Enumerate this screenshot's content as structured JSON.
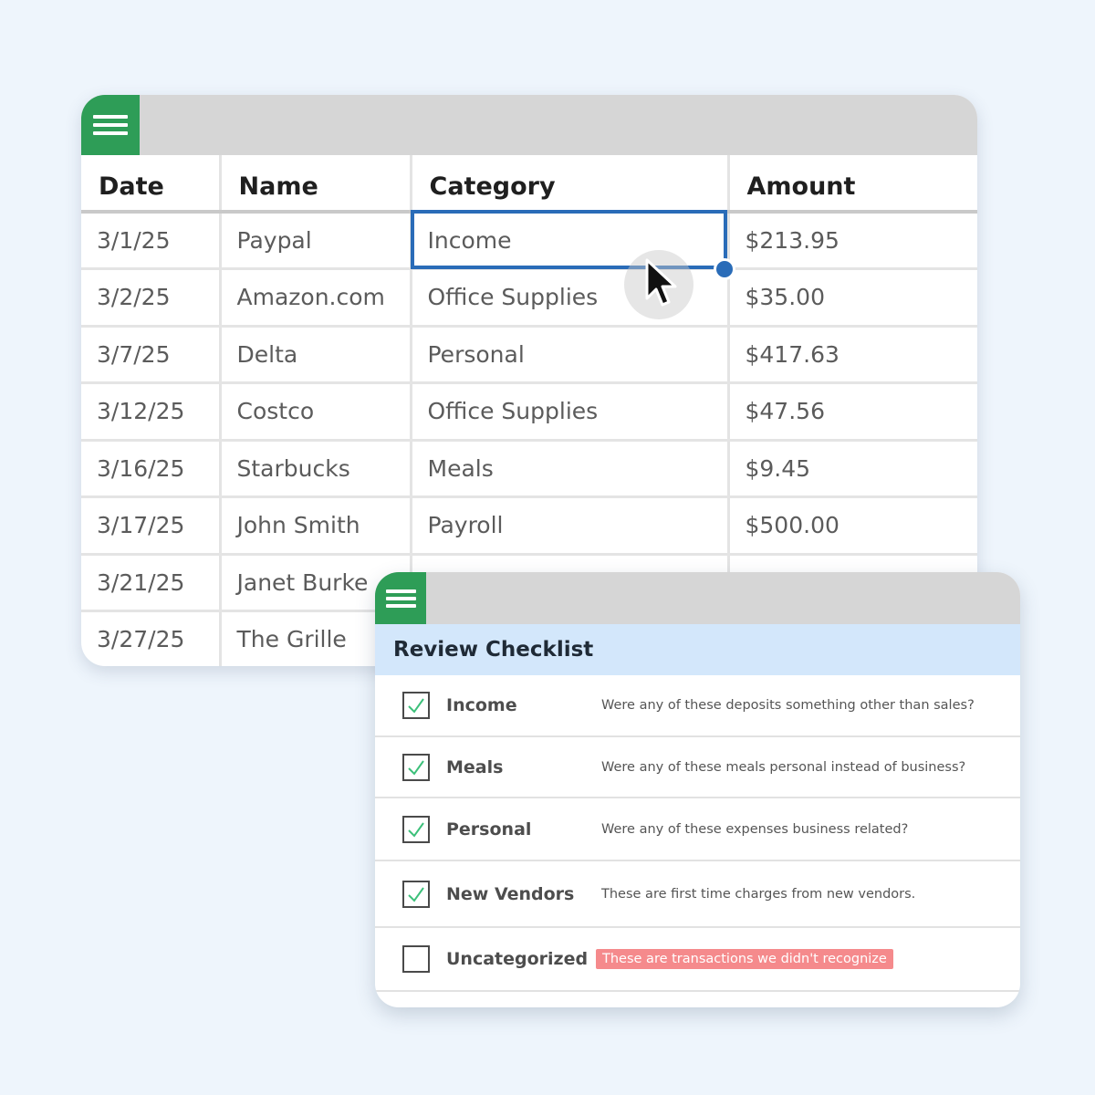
{
  "sheet": {
    "icon": "sheets-menu-icon",
    "columns": [
      "Date",
      "Name",
      "Category",
      "Amount"
    ],
    "rows": [
      [
        "3/1/25",
        "Paypal",
        "Income",
        "$213.95"
      ],
      [
        "3/2/25",
        "Amazon.com",
        "Office Supplies",
        "$35.00"
      ],
      [
        "3/7/25",
        "Delta",
        "Personal",
        "$417.63"
      ],
      [
        "3/12/25",
        "Costco",
        "Office Supplies",
        "$47.56"
      ],
      [
        "3/16/25",
        "Starbucks",
        "Meals",
        "$9.45"
      ],
      [
        "3/17/25",
        "John Smith",
        "Payroll",
        "$500.00"
      ],
      [
        "3/21/25",
        "Janet Burke",
        "",
        ""
      ],
      [
        "3/27/25",
        "The Grille",
        "",
        ""
      ]
    ],
    "selected_cell": "Income"
  },
  "checklist": {
    "icon": "sheets-menu-icon",
    "title": "Review Checklist",
    "items": [
      {
        "label": "Income",
        "checked": true,
        "description": "Were any of these deposits something other than sales?"
      },
      {
        "label": "Meals",
        "checked": true,
        "description": "Were any of these meals personal instead of business?"
      },
      {
        "label": "Personal",
        "checked": true,
        "description": "Were any of these expenses business related?"
      },
      {
        "label": "New Vendors",
        "checked": true,
        "description": "These are first time charges from new vendors."
      },
      {
        "label": "Uncategorized",
        "checked": false,
        "description": "These are transactions we didn't recognize",
        "highlight": true
      }
    ]
  },
  "colors": {
    "brand_green": "#2e9d57",
    "selection_blue": "#2a6cb8",
    "header_blue": "#d3e7fb",
    "check_green": "#3cc07a",
    "alert_red": "#f58a8c"
  }
}
